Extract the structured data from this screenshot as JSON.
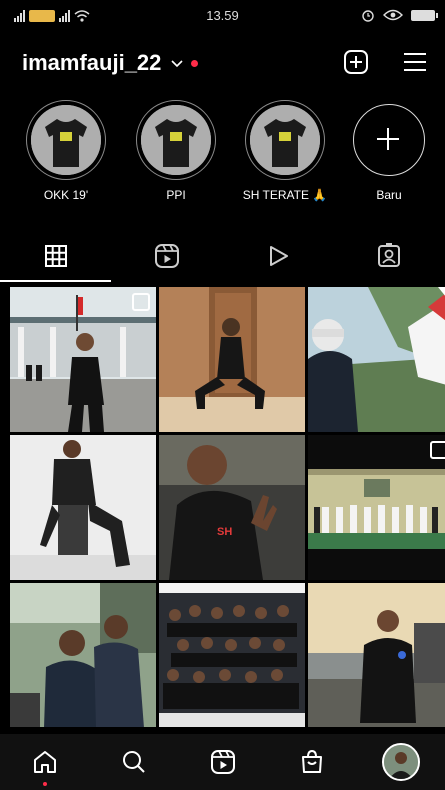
{
  "status_bar": {
    "time": "13.59"
  },
  "header": {
    "username": "imamfauji_22",
    "accent_color": "#ff2c49",
    "icons": [
      "chevron-down-icon",
      "add-post-icon",
      "menu-icon"
    ]
  },
  "highlights": {
    "items": [
      {
        "label": "OKK 19'"
      },
      {
        "label": "PPI"
      },
      {
        "label": "SH TERATE 🙏"
      }
    ],
    "new_label": "Baru"
  },
  "tabs": {
    "icons": [
      "grid-icon",
      "reels-icon",
      "video-icon",
      "tagged-icon"
    ],
    "active": "grid-icon"
  },
  "posts": [
    {
      "scene": "building-flag",
      "multi": true
    },
    {
      "scene": "stance-door",
      "multi": false
    },
    {
      "scene": "cap-flag",
      "multi": false
    },
    {
      "scene": "sitting-studio",
      "multi": false
    },
    {
      "scene": "smile-hoodie",
      "multi": false
    },
    {
      "scene": "group-hall",
      "multi": true
    },
    {
      "scene": "two-friends",
      "multi": false
    },
    {
      "scene": "crowd",
      "multi": false
    },
    {
      "scene": "harbor",
      "multi": false
    }
  ],
  "bottom_nav": {
    "icons": [
      "home-icon",
      "search-icon",
      "reels-icon",
      "shop-icon",
      "profile-avatar"
    ]
  }
}
